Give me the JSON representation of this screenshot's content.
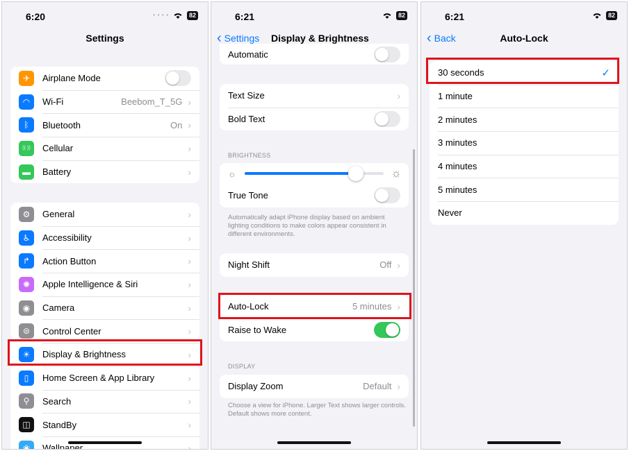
{
  "settings": {
    "time": "6:20",
    "battery": "82",
    "title": "Settings",
    "group1": [
      {
        "label": "Airplane Mode",
        "icon": "airplane-icon",
        "color": "#ff9500",
        "glyph": "✈",
        "toggle": "off"
      },
      {
        "label": "Wi-Fi",
        "icon": "wifi-icon",
        "color": "#0a7aff",
        "glyph": "◠",
        "value": "Beebom_T_5G"
      },
      {
        "label": "Bluetooth",
        "icon": "bluetooth-icon",
        "color": "#0a7aff",
        "glyph": "ᛒ",
        "value": "On"
      },
      {
        "label": "Cellular",
        "icon": "cellular-icon",
        "color": "#34c759",
        "glyph": "((·))"
      },
      {
        "label": "Battery",
        "icon": "battery-icon",
        "color": "#34c759",
        "glyph": "▬"
      }
    ],
    "group2": [
      {
        "label": "General",
        "icon": "gear-icon",
        "color": "#8e8e93",
        "glyph": "⚙"
      },
      {
        "label": "Accessibility",
        "icon": "accessibility-icon",
        "color": "#0a7aff",
        "glyph": "♿"
      },
      {
        "label": "Action Button",
        "icon": "action-button-icon",
        "color": "#0a7aff",
        "glyph": "↱"
      },
      {
        "label": "Apple Intelligence & Siri",
        "icon": "siri-icon",
        "color": "#c86bfa",
        "glyph": "✺"
      },
      {
        "label": "Camera",
        "icon": "camera-icon",
        "color": "#8e8e93",
        "glyph": "◉"
      },
      {
        "label": "Control Center",
        "icon": "control-center-icon",
        "color": "#8e8e93",
        "glyph": "⊜"
      },
      {
        "label": "Display & Brightness",
        "icon": "sun-icon",
        "color": "#0a7aff",
        "glyph": "☀"
      },
      {
        "label": "Home Screen & App Library",
        "icon": "home-screen-icon",
        "color": "#0a7aff",
        "glyph": "▯"
      },
      {
        "label": "Search",
        "icon": "search-icon",
        "color": "#8e8e93",
        "glyph": "⚲"
      },
      {
        "label": "StandBy",
        "icon": "standby-icon",
        "color": "#111111",
        "glyph": "◫"
      },
      {
        "label": "Wallpaper",
        "icon": "wallpaper-icon",
        "color": "#35aaf5",
        "glyph": "❀"
      }
    ]
  },
  "display": {
    "time": "6:21",
    "battery": "82",
    "back_label": "Settings",
    "title": "Display & Brightness",
    "automatic_label": "Automatic",
    "text_size_label": "Text Size",
    "bold_text_label": "Bold Text",
    "brightness_header": "BRIGHTNESS",
    "brightness_level": 0.8,
    "true_tone_label": "True Tone",
    "true_tone_note": "Automatically adapt iPhone display based on ambient lighting conditions to make colors appear consistent in different environments.",
    "night_shift_label": "Night Shift",
    "night_shift_value": "Off",
    "auto_lock_label": "Auto-Lock",
    "auto_lock_value": "5 minutes",
    "raise_to_wake_label": "Raise to Wake",
    "display_header": "DISPLAY",
    "display_zoom_label": "Display Zoom",
    "display_zoom_value": "Default",
    "display_zoom_note": "Choose a view for iPhone. Larger Text shows larger controls. Default shows more content."
  },
  "autolock": {
    "time": "6:21",
    "battery": "82",
    "back_label": "Back",
    "title": "Auto-Lock",
    "options": [
      "30 seconds",
      "1 minute",
      "2 minutes",
      "3 minutes",
      "4 minutes",
      "5 minutes",
      "Never"
    ],
    "selected": "30 seconds"
  },
  "colors": {
    "accent": "#0a7aff",
    "highlight": "#e0131b",
    "toggle_on": "#34c759"
  }
}
